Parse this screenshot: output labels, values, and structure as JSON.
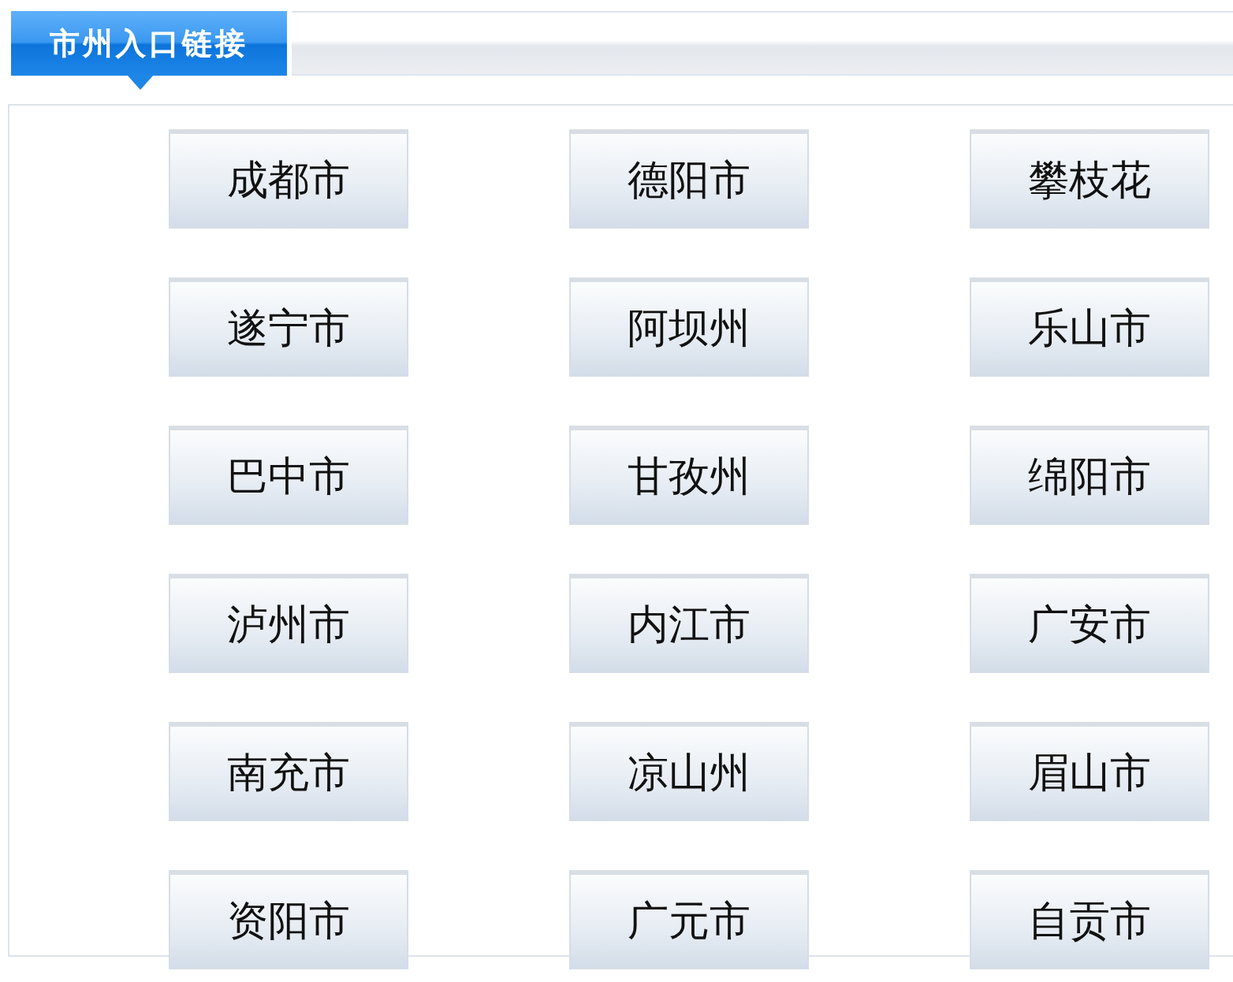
{
  "header": {
    "title": "市州入口链接"
  },
  "links": [
    "成都市",
    "德阳市",
    "攀枝花",
    "遂宁市",
    "阿坝州",
    "乐山市",
    "巴中市",
    "甘孜州",
    "绵阳市",
    "泸州市",
    "内江市",
    "广安市",
    "南充市",
    "凉山州",
    "眉山市",
    "资阳市",
    "广元市",
    "自贡市"
  ]
}
